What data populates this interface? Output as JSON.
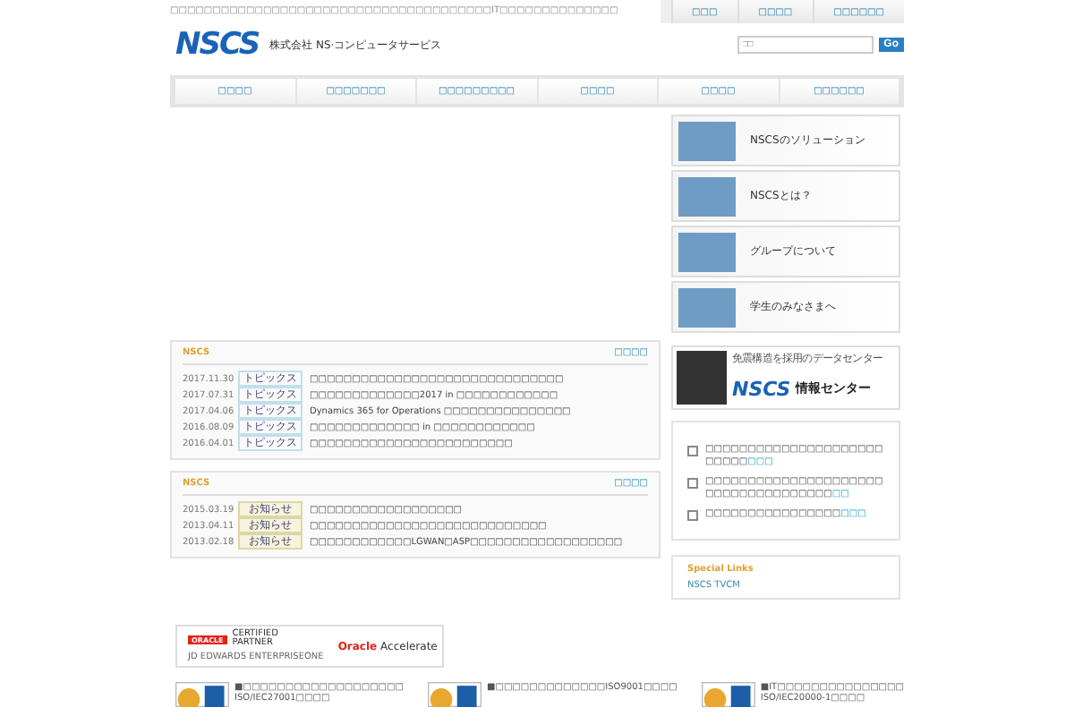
{
  "header": {
    "tagline": "□□□□□□□□□□□□□□□□□□□□□□□□□□□□□□□□□□□□□□IT□□□□□□□□□□□□□□",
    "logo": "NSCS",
    "company_name": "株式会社 NS·コンピュータサービス",
    "top_links": [
      "□□□",
      "□□□□",
      "□□□□□□"
    ],
    "search": {
      "placeholder": "□□",
      "button": "Go"
    }
  },
  "nav": [
    "□□□□",
    "□□□□□□□",
    "□□□□□□□□□",
    "□□□□",
    "□□□□",
    "□□□□□□"
  ],
  "news_panels": [
    {
      "title": "NSCS",
      "more": "□□□□",
      "items": [
        {
          "date": "2017.11.30",
          "kind": "topics",
          "category": "トピックス",
          "text": "□□□□□□□□□□□□□□□□□□□□□□□□□□□□□□"
        },
        {
          "date": "2017.07.31",
          "kind": "topics",
          "category": "トピックス",
          "text": "□□□□□□□□□□□□□2017 in □□□□□□□□□□□□"
        },
        {
          "date": "2017.04.06",
          "kind": "topics",
          "category": "トピックス",
          "text": "Dynamics 365 for Operations □□□□□□□□□□□□□□□"
        },
        {
          "date": "2016.08.09",
          "kind": "topics",
          "category": "トピックス",
          "text": "□□□□□□□□□□□□□ in □□□□□□□□□□□□"
        },
        {
          "date": "2016.04.01",
          "kind": "topics",
          "category": "トピックス",
          "text": "□□□□□□□□□□□□□□□□□□□□□□□□"
        }
      ]
    },
    {
      "title": "NSCS",
      "more": "□□□□",
      "items": [
        {
          "date": "2015.03.19",
          "kind": "notice",
          "category": "お知らせ",
          "text": "□□□□□□□□□□□□□□□□□□"
        },
        {
          "date": "2013.04.11",
          "kind": "notice",
          "category": "お知らせ",
          "text": "□□□□□□□□□□□□□□□□□□□□□□□□□□□□"
        },
        {
          "date": "2013.02.18",
          "kind": "notice",
          "category": "お知らせ",
          "text": "□□□□□□□□□□□□LGWAN□ASP□□□□□□□□□□□□□□□□□□"
        }
      ]
    }
  ],
  "side_banners": [
    {
      "label": "NSCSのソリューション"
    },
    {
      "label": "NSCSとは？"
    },
    {
      "label": "グループについて"
    },
    {
      "label": "学生のみなさまへ"
    }
  ],
  "datacenter_banner": {
    "caption": "免震構造を採用のデータセンター",
    "logo": "NSCS",
    "name": "情報センター"
  },
  "link_list": [
    {
      "text": "□□□□□□□□□□□□□□□□□□□□□□□□□□",
      "link": "□□□"
    },
    {
      "text": "□□□□□□□□□□□□□□□□□□□□□□□□□□□□□□□□□□□□",
      "link": "□□"
    },
    {
      "text": "□□□□□□□□□□□□□□□□",
      "link": "□□□"
    }
  ],
  "special_links": {
    "title": "Special Links",
    "items": [
      "NSCS TVCM"
    ]
  },
  "partner_badge": {
    "oracle": "ORACLE",
    "certified": "CERTIFIED PARTNER",
    "sub": "JD EDWARDS ENTERPRISEONE",
    "brand": "Oracle",
    "program": "Accelerate"
  },
  "certifications": [
    {
      "lines": [
        "■□□□□□□□□□□□□□□□□□□□",
        "ISO/IEC27001□□□□"
      ]
    },
    {
      "lines": [
        "■□□□□□□□□□□□□□ISO9001□□□□"
      ]
    },
    {
      "lines": [
        "■IT□□□□□□□□□□□□□□□",
        "ISO/IEC20000-1□□□□"
      ]
    }
  ]
}
